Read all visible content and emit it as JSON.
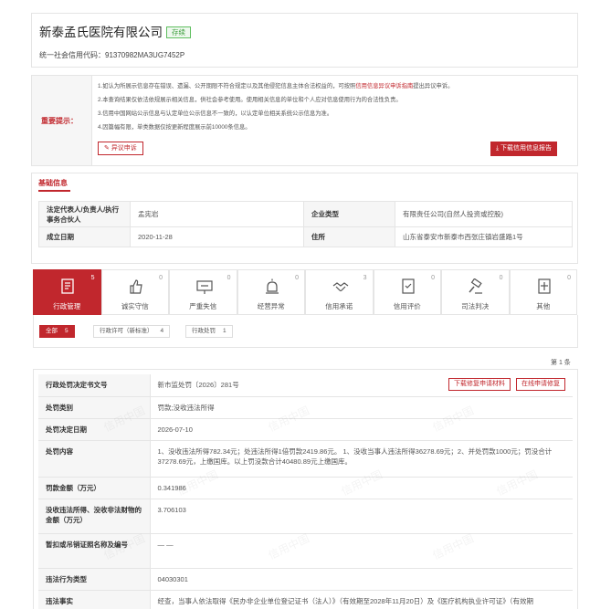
{
  "header": {
    "company_name": "新泰孟氏医院有限公司",
    "status_badge": "存续",
    "credit_code_label": "统一社会信用代码：",
    "credit_code": "91370982MA3UG7452P"
  },
  "notice": {
    "label": "重要提示：",
    "line1_pre": "1.如认为所展示信息存在错误、遗漏、公开期限不符合规定以及其他侵犯信息主体合法权益的，可按照",
    "line1_link": "信用信息异议申诉指南",
    "line1_post": "提出异议申诉。",
    "line2": "2.本查询结果仅依法依规展示相关信息，供社会参考使用。使用相关信息的单位和个人应对信息使用行为的合法性负责。",
    "line3": "3.信用中国网站公示信息与认定单位公示信息不一致的，以认定单位相关系统公示信息为准。",
    "line4": "4.因篇幅有限，单类数据仅按更新程度展示前10000条信息。",
    "objection_button": "异议申诉",
    "download_button": "下载信用信息报告"
  },
  "basic_info": {
    "title": "基础信息",
    "rows": [
      {
        "label1": "法定代表人/负责人/执行事务合伙人",
        "value1": "孟宪岩",
        "label2": "企业类型",
        "value2": "有限责任公司(自然人投资或控股)"
      },
      {
        "label1": "成立日期",
        "value1": "2020-11-28",
        "label2": "住所",
        "value2": "山东省泰安市新泰市西张庄镇岩盛路1号"
      }
    ]
  },
  "tabs": [
    {
      "label": "行政管理",
      "count": "5",
      "icon": "admin-doc-icon",
      "active": true
    },
    {
      "label": "诚实守信",
      "count": "0",
      "icon": "thumbs-up-icon"
    },
    {
      "label": "严重失信",
      "count": "0",
      "icon": "warning-sign-icon"
    },
    {
      "label": "经营异常",
      "count": "0",
      "icon": "alarm-light-icon"
    },
    {
      "label": "信用承诺",
      "count": "3",
      "icon": "handshake-icon"
    },
    {
      "label": "信用评价",
      "count": "0",
      "icon": "rating-doc-icon"
    },
    {
      "label": "司法判决",
      "count": "0",
      "icon": "gavel-icon"
    },
    {
      "label": "其他",
      "count": "0",
      "icon": "other-doc-icon"
    }
  ],
  "filters": [
    {
      "label": "全部",
      "count": "5",
      "active": true
    },
    {
      "label": "行政许可（新标准）",
      "count": "4"
    },
    {
      "label": "行政处罚",
      "count": "1"
    }
  ],
  "page_indicator": "第 1 条",
  "detail": {
    "doc_no_label": "行政处罚决定书文号",
    "doc_no": "新市监处罚〔2026〕281号",
    "btn_repair_materials": "下载修复申请材料",
    "btn_online_repair": "在线申请修复",
    "category_label": "处罚类别",
    "category": "罚款;没收违法所得",
    "date_label": "处罚决定日期",
    "date": "2026-07-10",
    "content_label": "处罚内容",
    "content": "1、没收违法所得782.34元；处违法所得1倍罚款2419.86元。 1、没收当事人违法所得36278.69元；2、并处罚款1000元；罚没合计37278.69元，上缴国库。以上罚没款合计40480.89元上缴国库。",
    "fine_label": "罚款金额（万元）",
    "fine": "0.341986",
    "confiscation_label": "没收违法所得、没收非法财物的金额（万元）",
    "confiscation": "3.706103",
    "license_label": "暂扣或吊销证照名称及编号",
    "license": "— —",
    "violation_type_label": "违法行为类型",
    "violation_type": "04030301",
    "facts_label": "违法事实",
    "facts": "经查，当事人依法取得《民办非企业单位登记证书（法人）》（有效期至2028年11月20日）及《医疗机构执业许可证》（有效期"
  },
  "watermark_text": "信用中国"
}
